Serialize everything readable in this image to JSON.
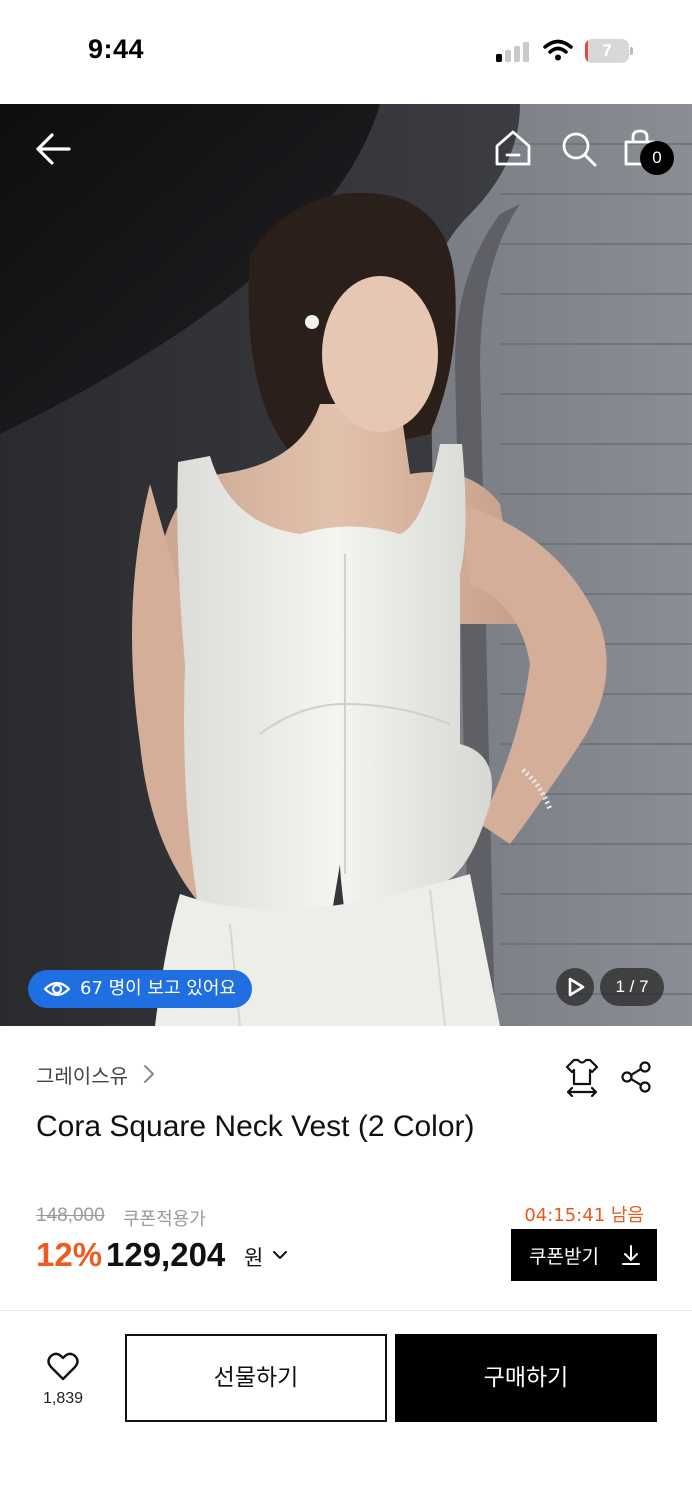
{
  "status_bar": {
    "time": "9:44",
    "battery_level": "7"
  },
  "header": {
    "icons": [
      "back-arrow-icon",
      "home-icon",
      "search-icon",
      "shopping-bag-icon"
    ],
    "cart_count": "0"
  },
  "gallery": {
    "viewers_text": "67 명이 보고 있어요",
    "pager": "1 / 7",
    "colors": {
      "viewers_pill": "#1f6fe3"
    }
  },
  "product": {
    "brand": "그레이스유",
    "title": "Cora Square Neck Vest (2 Color)",
    "original_price": "148,000",
    "coupon_applied_label": "쿠폰적용가",
    "timer": "04:15:41 남음",
    "discount": "12%",
    "sale_price": "129,204",
    "currency": "원",
    "coupon_button_label": "쿠폰받기",
    "colors": {
      "discount": "#ef5a1e",
      "timer": "#e65c1c"
    }
  },
  "bottom_bar": {
    "like_count": "1,839",
    "gift_label": "선물하기",
    "buy_label": "구매하기"
  }
}
